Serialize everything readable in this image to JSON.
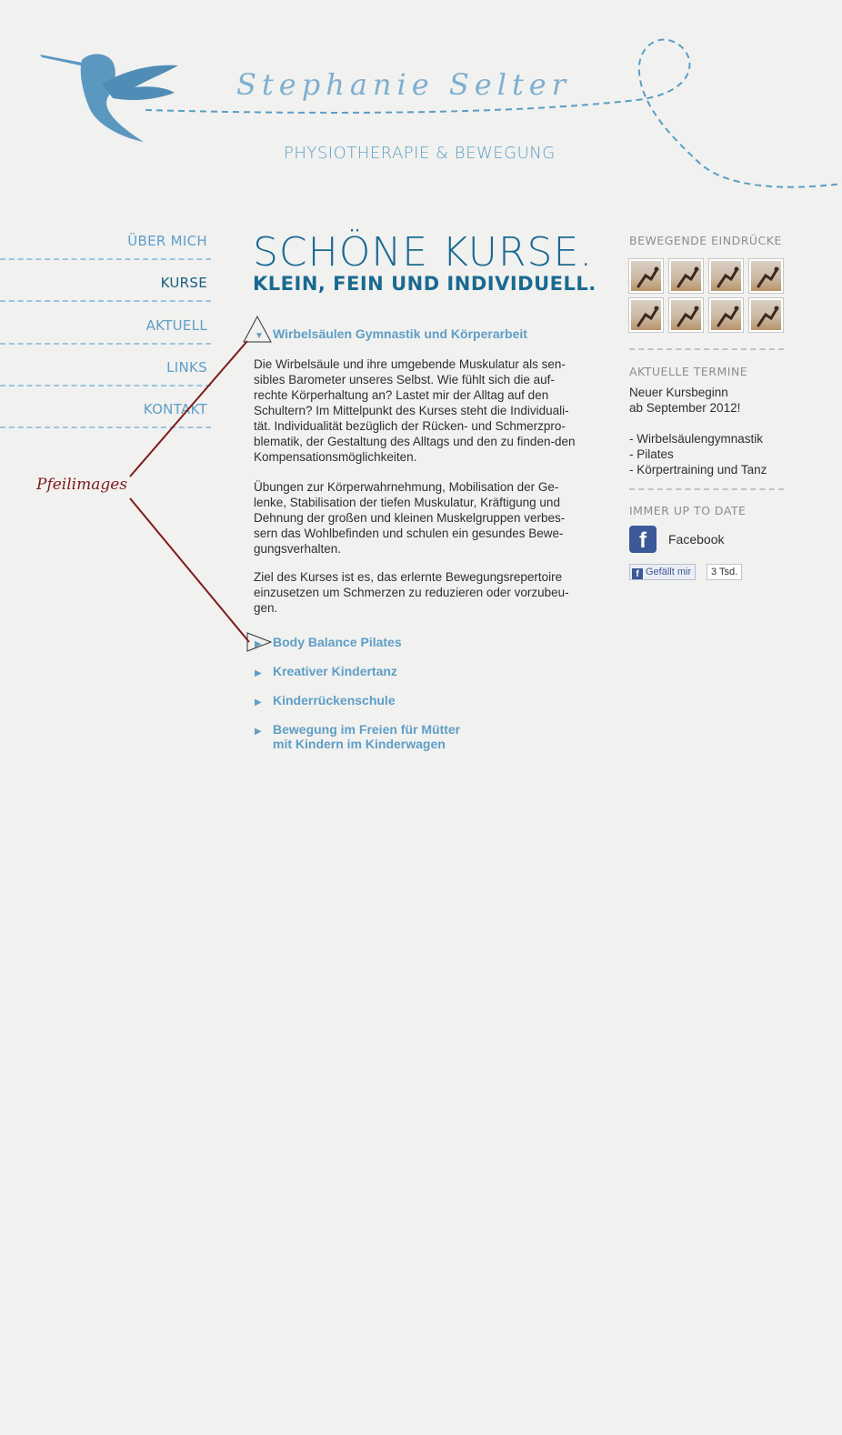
{
  "header": {
    "signature": "Stephanie Selter",
    "tagline": "Physiotherapie & Bewegung"
  },
  "nav": {
    "items": [
      {
        "label": "Über mich"
      },
      {
        "label": "Kurse"
      },
      {
        "label": "Aktuell"
      },
      {
        "label": "Links"
      },
      {
        "label": "Kontakt"
      }
    ],
    "active": "Kurse"
  },
  "main": {
    "title": "Schöne Kurse.",
    "subtitle": "Klein, fein und individuell.",
    "accordion": {
      "open": {
        "title": "Wirbelsäulen Gymnastik und Körperarbeit",
        "paragraphs": [
          "Die Wirbelsäule und ihre umgebende Muskulatur als sen-sibles Barometer unseres Selbst. Wie fühlt sich die auf-rechte Körperhaltung an? Lastet mir der Alltag auf den Schultern? Im Mittelpunkt des Kurses steht die Individuali-tät. Individualität bezüglich der Rücken- und Schmerzpro-blematik, der Gestaltung des Alltags und den zu finden-den Kompensationsmöglichkeiten.",
          "Übungen zur Körperwahrnehmung, Mobilisation der Ge-lenke, Stabilisation der tiefen Muskulatur, Kräftigung und Dehnung der großen und kleinen Muskelgruppen verbes-sern das Wohlbefinden und schulen ein gesundes Bewe-gungsverhalten.",
          "Ziel des Kurses ist es, das erlernte Bewegungsrepertoire einzusetzen um Schmerzen zu reduzieren oder vorzubeu-gen."
        ]
      },
      "closed": [
        {
          "title": "Body Balance Pilates"
        },
        {
          "title": "Kreativer Kindertanz"
        },
        {
          "title": "Kinderrückenschule"
        },
        {
          "title_line1": "Bewegung im Freien für Mütter",
          "title_line2": "mit Kindern im Kinderwagen"
        }
      ],
      "icons": {
        "open": "triangle-down-icon",
        "closed": "triangle-right-icon"
      }
    }
  },
  "sidebar": {
    "gallery_title": "Bewegende Eindrücke",
    "gallery_count": 8,
    "events_title": "Aktuelle Termine",
    "events_line1": "Neuer Kursbeginn",
    "events_line2": "ab September 2012!",
    "events_items": [
      "- Wirbelsäulengymnastik",
      "- Pilates",
      "- Körpertraining und Tanz"
    ],
    "social_title": "Immer up to date",
    "facebook_label": "Facebook",
    "like_label": "Gefällt mir",
    "like_count": "3 Tsd."
  },
  "annotation": {
    "label": "Pfeilimages"
  },
  "colors": {
    "background": "#f1f1f0",
    "brand_blue": "#5a9ec4",
    "title_blue": "#1a6a90",
    "active_nav": "#17607f",
    "annotation_red": "#7f1a1a",
    "facebook_blue": "#3b5998"
  }
}
